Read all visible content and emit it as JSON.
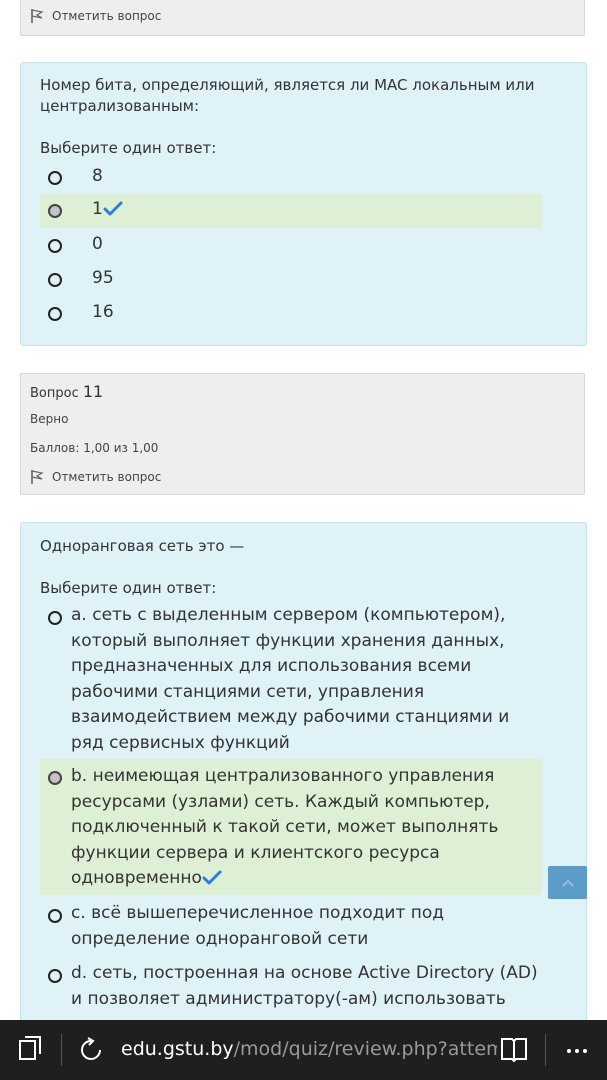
{
  "prev_question": {
    "flag_label": "Отметить вопрос"
  },
  "question10": {
    "text": "Номер бита, определяющий, является ли MAC локальным или централизованным:",
    "prompt": "Выберите один ответ:",
    "options": [
      {
        "label": "8",
        "selected": false,
        "correct": false
      },
      {
        "label": "1",
        "selected": true,
        "correct": true
      },
      {
        "label": "0",
        "selected": false,
        "correct": false
      },
      {
        "label": "95",
        "selected": false,
        "correct": false
      },
      {
        "label": "16",
        "selected": false,
        "correct": false
      }
    ]
  },
  "question11_info": {
    "label": "Вопрос",
    "number": "11",
    "status": "Верно",
    "score": "Баллов: 1,00 из 1,00",
    "flag_label": "Отметить вопрос"
  },
  "question11": {
    "text": "Одноранговая сеть это —",
    "prompt": "Выберите один ответ:",
    "options": [
      {
        "label": "a. сеть с выделенным сервером (компьютером), который выполняет функции хранения данных, предназначенных для использования всеми рабочими станциями сети, управления взаимодействием между рабочими станциями и ряд сервисных функций",
        "selected": false,
        "correct": false
      },
      {
        "label": "b. неимеющая централизованного управления ресурсами (узлами) сеть. Каждый компьютер, подключенный к такой сети, может выполнять функции сервера и клиентского ресурса одновременно",
        "selected": true,
        "correct": true
      },
      {
        "label": "c. всё вышеперечисленное подходит под определение одноранговой сети",
        "selected": false,
        "correct": false
      },
      {
        "label": "d. сеть, построенная на основе Active Directory (AD) и позволяет администратору(-ам) использовать",
        "selected": false,
        "correct": false
      }
    ]
  },
  "colors": {
    "question_bg": "#def2f8",
    "correct_bg": "#ddf0d5",
    "info_bg": "#eeeeee",
    "check": "#2f7fd6",
    "taskbar": "#1f1f1f"
  },
  "taskbar": {
    "url_domain": "edu.gstu.by",
    "url_path": "/mod/quiz/review.php?attempt=",
    "icons": [
      "tabs-icon",
      "refresh-icon",
      "reading-view-icon",
      "more-icon"
    ]
  }
}
